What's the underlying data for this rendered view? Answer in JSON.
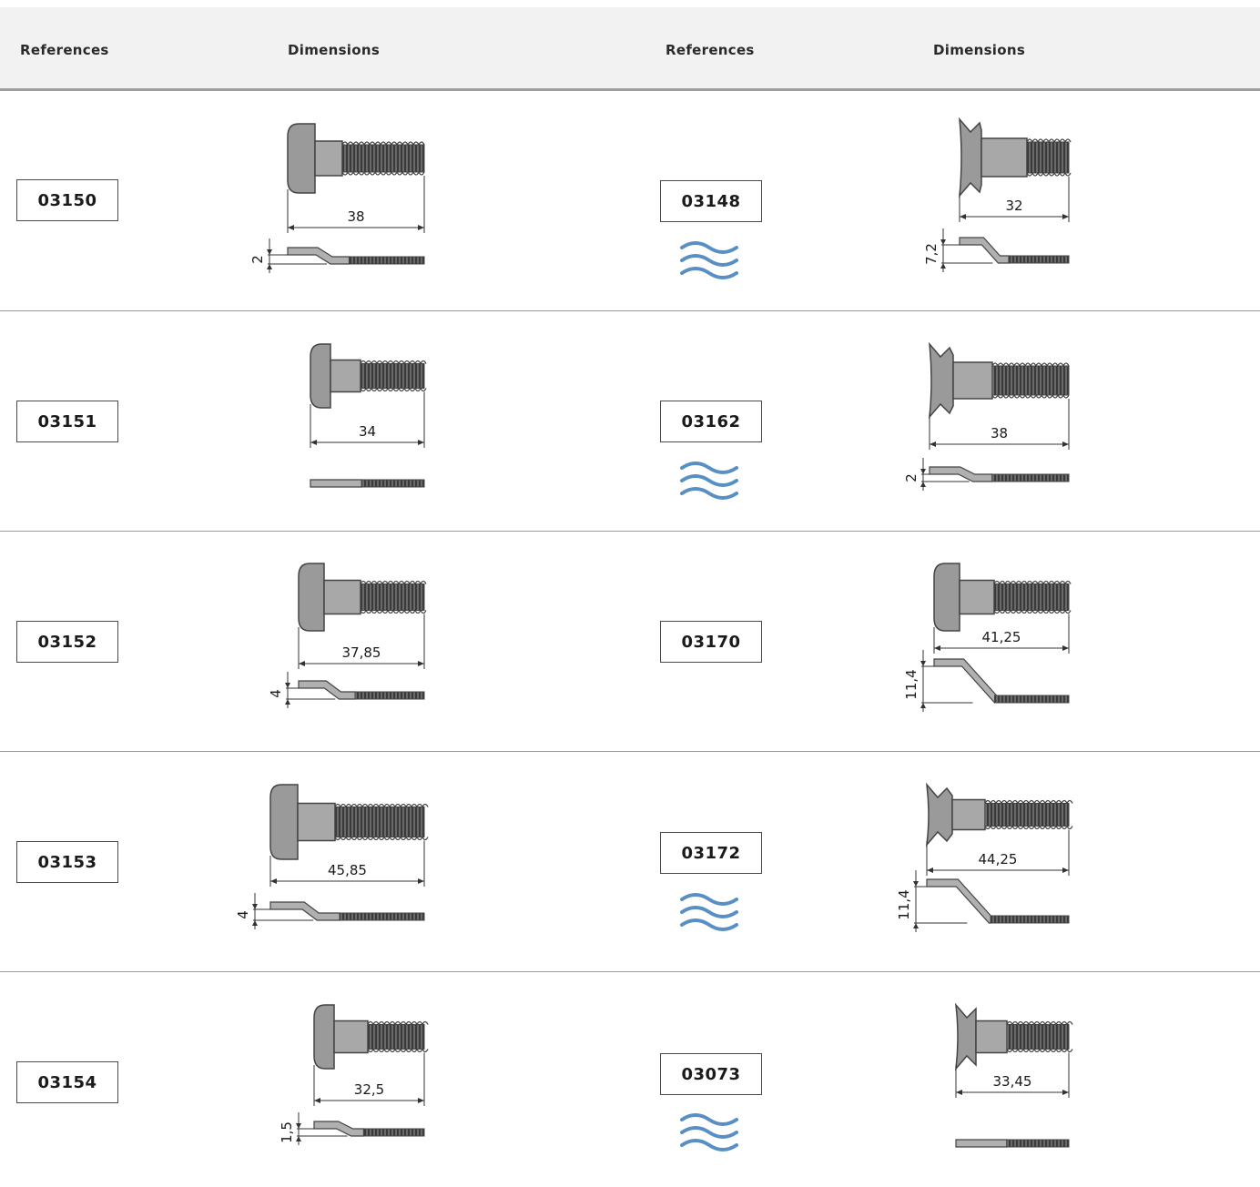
{
  "header": {
    "col1_label": "References",
    "col2_label": "Dimensions",
    "col3_label": "References",
    "col4_label": "Dimensions"
  },
  "left_column": [
    {
      "reference": "03150",
      "length": "38",
      "offset": "2"
    },
    {
      "reference": "03151",
      "length": "34",
      "offset": ""
    },
    {
      "reference": "03152",
      "length": "37,85",
      "offset": "4"
    },
    {
      "reference": "03153",
      "length": "45,85",
      "offset": "4"
    },
    {
      "reference": "03154",
      "length": "32,5",
      "offset": "1,5"
    }
  ],
  "right_column": [
    {
      "reference": "03148",
      "length": "32",
      "offset": "7,2",
      "wave_icon": true
    },
    {
      "reference": "03162",
      "length": "38",
      "offset": "2",
      "wave_icon": true
    },
    {
      "reference": "03170",
      "length": "41,25",
      "offset": "11,4",
      "wave_icon": false
    },
    {
      "reference": "03172",
      "length": "44,25",
      "offset": "11,4",
      "wave_icon": true
    },
    {
      "reference": "03073",
      "length": "33,45",
      "offset": "",
      "wave_icon": true
    }
  ],
  "colors": {
    "header_background": "#f2f2f2",
    "wave_icon": "#5a8fc4",
    "part_fill": "#9a9a9a",
    "thread_fill": "#3a3a3a"
  }
}
